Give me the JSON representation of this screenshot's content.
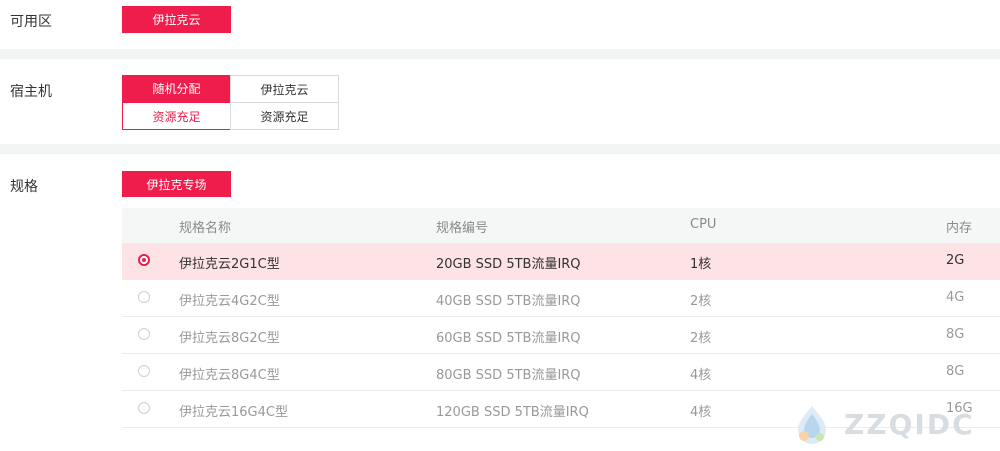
{
  "availability_zone": {
    "label": "可用区",
    "option": "伊拉克云"
  },
  "host": {
    "label": "宿主机",
    "options": [
      {
        "name": "随机分配",
        "status": "资源充足",
        "selected": true
      },
      {
        "name": "伊拉克云",
        "status": "资源充足",
        "selected": false
      }
    ]
  },
  "spec": {
    "label": "规格",
    "category_button": "伊拉克专场",
    "table": {
      "headers": [
        "规格名称",
        "规格编号",
        "CPU",
        "内存"
      ],
      "rows": [
        {
          "name": "伊拉克云2G1C型",
          "code": "20GB SSD 5TB流量IRQ",
          "cpu": "1核",
          "mem": "2G",
          "selected": true
        },
        {
          "name": "伊拉克云4G2C型",
          "code": "40GB SSD 5TB流量IRQ",
          "cpu": "2核",
          "mem": "4G",
          "selected": false
        },
        {
          "name": "伊拉克云8G2C型",
          "code": "60GB SSD 5TB流量IRQ",
          "cpu": "2核",
          "mem": "8G",
          "selected": false
        },
        {
          "name": "伊拉克云8G4C型",
          "code": "80GB SSD 5TB流量IRQ",
          "cpu": "4核",
          "mem": "8G",
          "selected": false
        },
        {
          "name": "伊拉克云16G4C型",
          "code": "120GB SSD 5TB流量IRQ",
          "cpu": "4核",
          "mem": "16G",
          "selected": false
        }
      ]
    }
  },
  "watermark": {
    "text": "ZZQIDC"
  },
  "colors": {
    "accent": "#ee1d4b",
    "selected_row": "#fde2e6"
  }
}
